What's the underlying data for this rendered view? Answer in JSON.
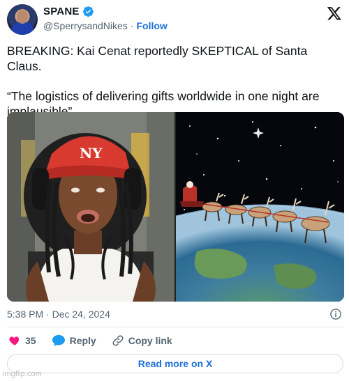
{
  "author": {
    "display_name": "SPANE",
    "handle": "@SperrysandNikes",
    "separator": "·",
    "follow_label": "Follow"
  },
  "tweet": {
    "line1": "BREAKING: Kai Cenat reportedly SKEPTICAL of Santa Claus.",
    "line2": "“The logistics of delivering gifts worldwide in one night are implausible”"
  },
  "meta": {
    "timestamp": "5:38 PM · Dec 24, 2024"
  },
  "actions": {
    "like_count": "35",
    "reply_label": "Reply",
    "copy_label": "Copy link"
  },
  "read_more_label": "Read more on X",
  "watermark": "imgflip.com",
  "icons": {
    "verified": "verified-badge-icon",
    "x_logo": "x-logo-icon",
    "info": "info-icon",
    "like": "heart-icon",
    "reply": "speech-bubble-icon",
    "copy": "link-icon"
  },
  "colors": {
    "accent": "#1d6fd8",
    "like": "#f91880",
    "muted": "#536471"
  }
}
